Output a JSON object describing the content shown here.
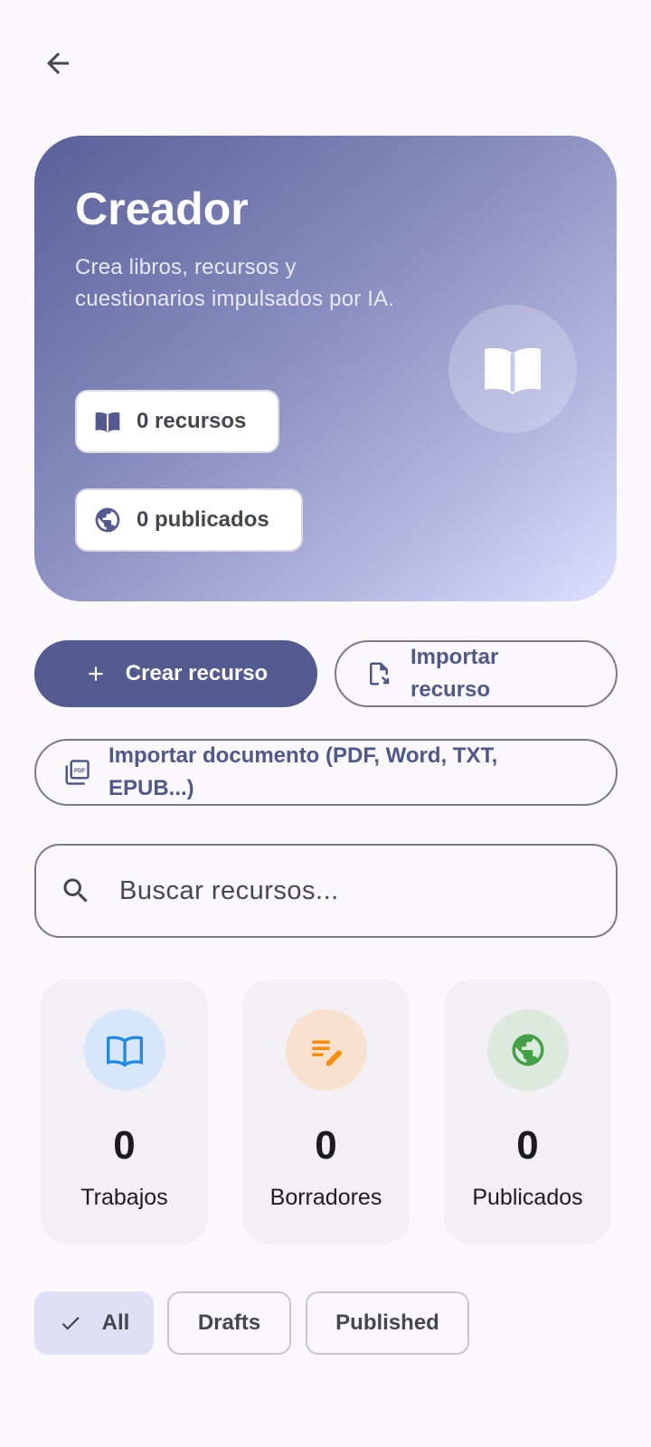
{
  "hero": {
    "title": "Creador",
    "subtitle": "Crea libros, recursos y cuestionarios impulsados por IA.",
    "badge_resources": "0 recursos",
    "badge_published": "0 publicados"
  },
  "actions": {
    "create": "Crear recurso",
    "import_resource": "Importar recurso",
    "import_document": "Importar documento (PDF, Word, TXT, EPUB...)"
  },
  "search": {
    "placeholder": "Buscar recursos..."
  },
  "stats": [
    {
      "value": "0",
      "label": "Trabajos",
      "icon": "book-icon",
      "color": "#1e88e5"
    },
    {
      "value": "0",
      "label": "Borradores",
      "icon": "edit-note-icon",
      "color": "#fb8c00"
    },
    {
      "value": "0",
      "label": "Publicados",
      "icon": "globe-icon",
      "color": "#43a047"
    }
  ],
  "filters": {
    "all": "All",
    "drafts": "Drafts",
    "published": "Published",
    "selected": "All"
  },
  "colors": {
    "primary": "#525a8f",
    "background": "#faf8fd"
  }
}
